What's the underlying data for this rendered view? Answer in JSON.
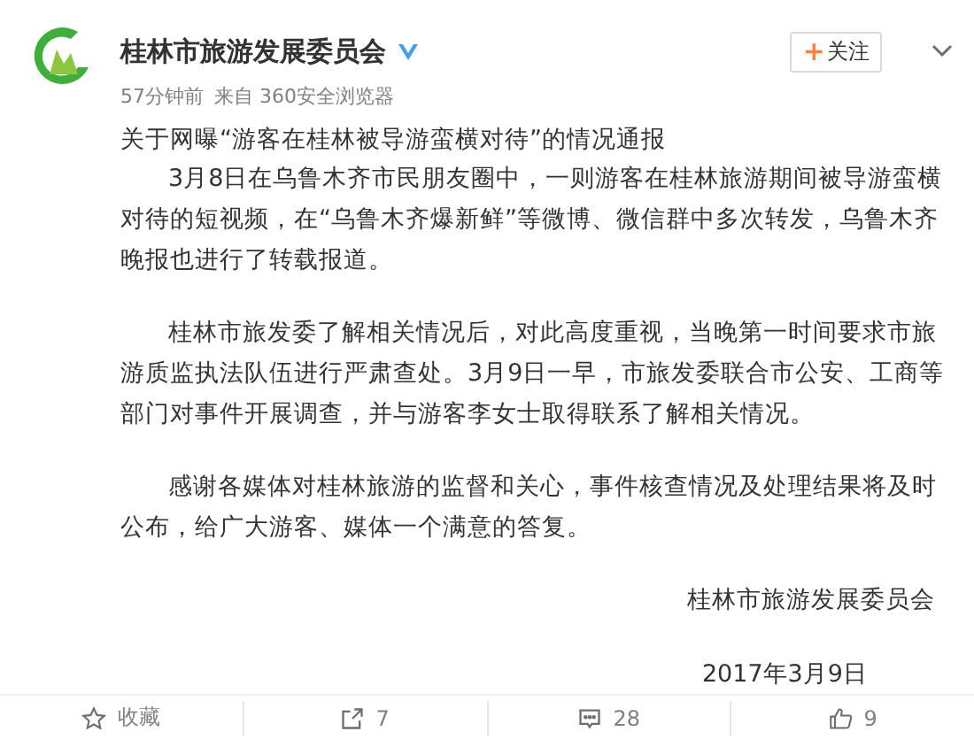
{
  "author": {
    "name": "桂林市旅游发展委员会",
    "verified": true,
    "follow_label": "关注",
    "follow_sign": "+"
  },
  "meta": {
    "time": "57分钟前",
    "source": "来自 360安全浏览器"
  },
  "post": {
    "title": "关于网曝“游客在桂林被导游蛮横对待”的情况通报",
    "paragraphs": [
      "3月8日在乌鲁木齐市民朋友圈中，一则游客在桂林旅游期间被导游蛮横对待的短视频，在“乌鲁木齐爆新鲜”等微博、微信群中多次转发，乌鲁木齐晚报也进行了转载报道。",
      "桂林市旅发委了解相关情况后，对此高度重视，当晚第一时间要求市旅游质监执法队伍进行严肃查处。3月9日一早，市旅发委联合市公安、工商等部门对事件开展调查，并与游客李女士取得联系了解相关情况。",
      "感谢各媒体对桂林旅游的监督和关心，事件核查情况及处理结果将及时公布，给广大游客、媒体一个满意的答复。"
    ],
    "signature": "桂林市旅游发展委员会",
    "date": "2017年3月9日"
  },
  "actions": [
    {
      "kind": "favorite",
      "label": "收藏"
    },
    {
      "kind": "repost",
      "label": "7"
    },
    {
      "kind": "comment",
      "label": "28"
    },
    {
      "kind": "like",
      "label": "9"
    }
  ]
}
